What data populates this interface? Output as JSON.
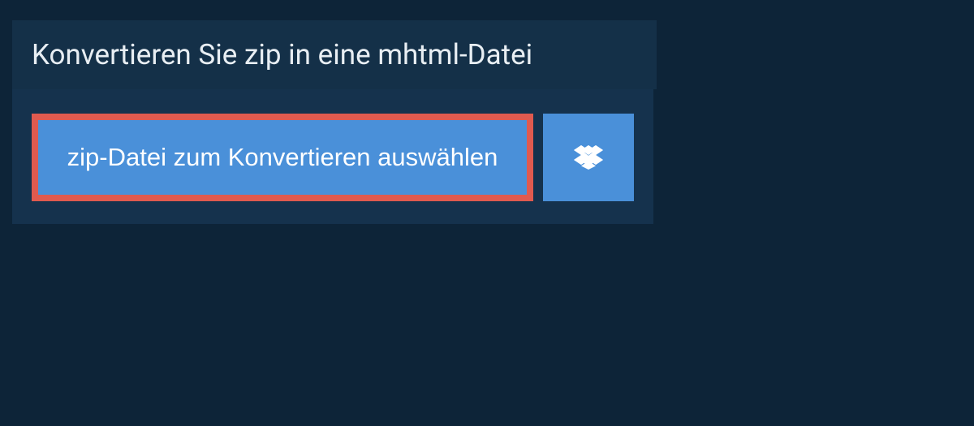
{
  "header": {
    "title": "Konvertieren Sie zip in eine mhtml-Datei"
  },
  "buttons": {
    "select_file_label": "zip-Datei zum Konvertieren auswählen"
  }
}
